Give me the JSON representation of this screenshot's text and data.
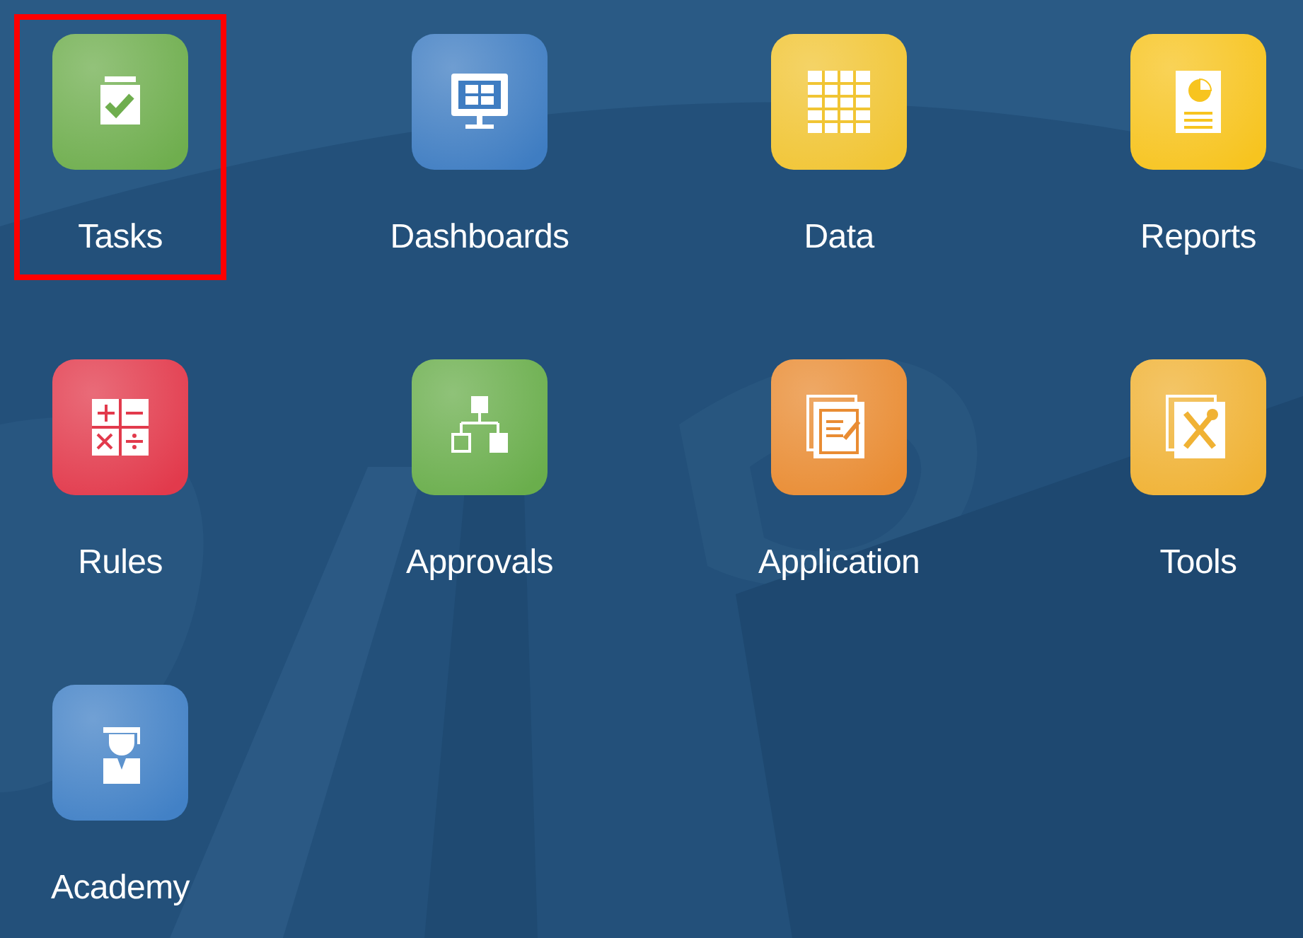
{
  "tiles": [
    {
      "label": "Tasks",
      "color": "#6fae4e",
      "highlighted": true
    },
    {
      "label": "Dashboards",
      "color": "#3f7dc2",
      "highlighted": false
    },
    {
      "label": "Data",
      "color": "#f1c534",
      "highlighted": false
    },
    {
      "label": "Reports",
      "color": "#f7c41f",
      "highlighted": false
    },
    {
      "label": "Rules",
      "color": "#e23a4c",
      "highlighted": false
    },
    {
      "label": "Approvals",
      "color": "#6aae4c",
      "highlighted": false
    },
    {
      "label": "Application",
      "color": "#e98c33",
      "highlighted": false
    },
    {
      "label": "Tools",
      "color": "#f0b234",
      "highlighted": false
    },
    {
      "label": "Academy",
      "color": "#4281c6",
      "highlighted": false
    }
  ]
}
